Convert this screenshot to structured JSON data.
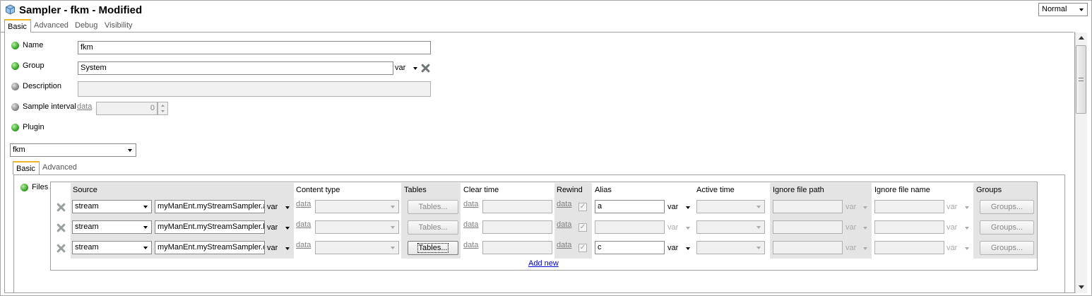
{
  "window": {
    "title": "Sampler - fkm - Modified",
    "mode": "Normal"
  },
  "tabs": [
    "Basic",
    "Advanced",
    "Debug",
    "Visibility"
  ],
  "fields": {
    "name": {
      "label": "Name",
      "value": "fkm"
    },
    "group": {
      "label": "Group",
      "value": "System",
      "var": "var"
    },
    "description": {
      "label": "Description",
      "value": ""
    },
    "sample_interval": {
      "label": "Sample interval",
      "link": "data",
      "value": "0"
    },
    "plugin": {
      "label": "Plugin",
      "selected": "fkm"
    }
  },
  "plugin_tabs": [
    "Basic",
    "Advanced"
  ],
  "files": {
    "label": "Files",
    "columns": [
      "Source",
      "Content type",
      "Tables",
      "Clear time",
      "Rewind",
      "Alias",
      "Active time",
      "Ignore file path",
      "Ignore file name",
      "Groups"
    ],
    "rows": [
      {
        "type": "stream",
        "source": "myManEnt.myStreamSampler.a",
        "var": "var",
        "data": "data",
        "tables": "Tables...",
        "clear_data": "data",
        "rewind_data": "data",
        "alias": "a",
        "alias_var": "var",
        "path_var": "var",
        "name_var": "var",
        "groups": "Groups..."
      },
      {
        "type": "stream",
        "source": "myManEnt.myStreamSampler.b",
        "var": "var",
        "data": "data",
        "tables": "Tables...",
        "clear_data": "data",
        "rewind_data": "data",
        "alias": "",
        "alias_var": "var",
        "path_var": "var",
        "name_var": "var",
        "groups": "Groups..."
      },
      {
        "type": "stream",
        "source": "myManEnt.myStreamSampler.c",
        "var": "var",
        "data": "data",
        "tables": "Tables...",
        "clear_data": "data",
        "rewind_data": "data",
        "alias": "c",
        "alias_var": "var",
        "path_var": "var",
        "name_var": "var",
        "groups": "Groups..."
      }
    ],
    "add_new": "Add new"
  },
  "colors": {
    "tab_accent": "#f0b429",
    "status_green": "#3aa42a",
    "status_gray": "#8c8c8c",
    "link_blue": "#0000cc"
  }
}
